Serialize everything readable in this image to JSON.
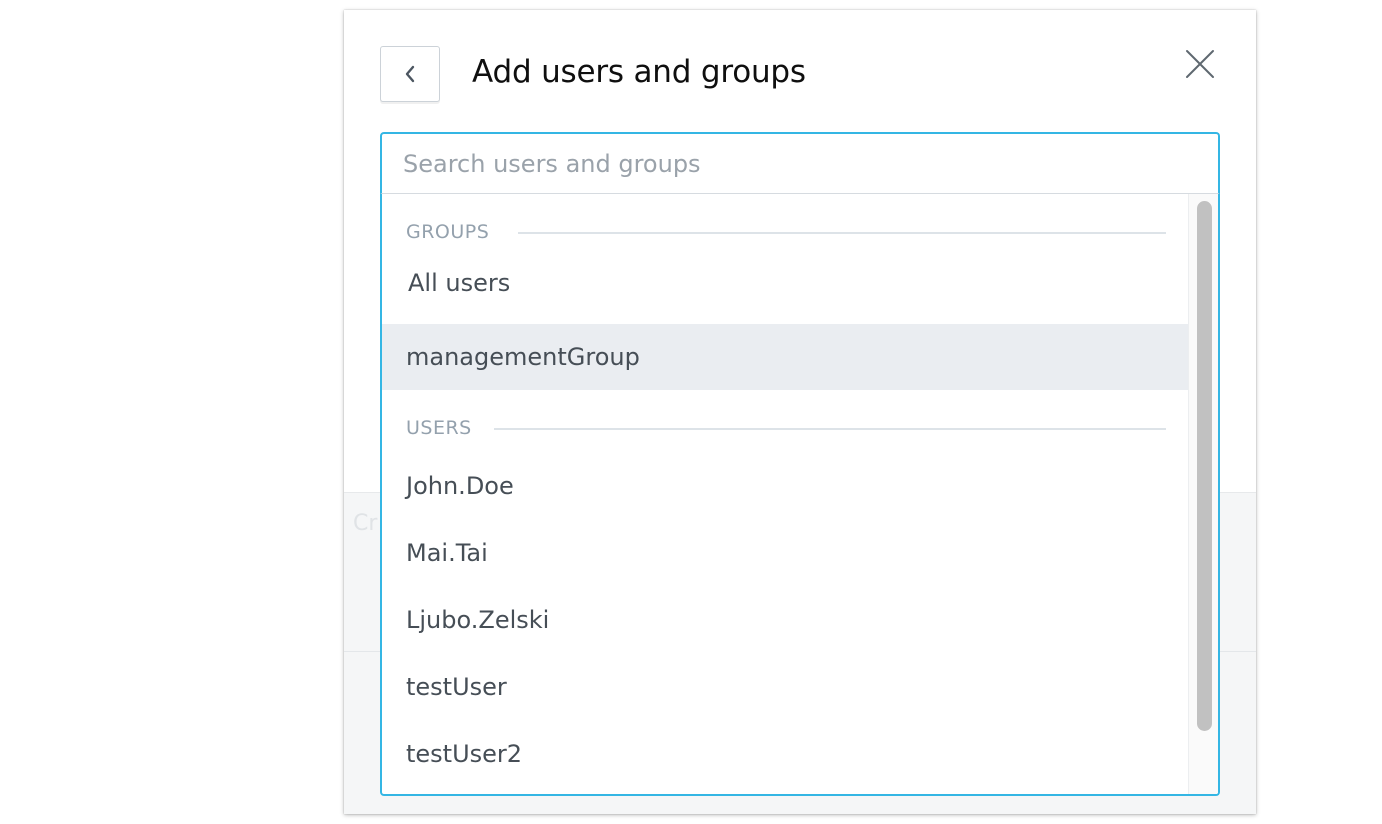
{
  "dialog": {
    "title": "Add users and groups",
    "back_icon": "chevron-left-icon",
    "close_icon": "close-icon"
  },
  "background": {
    "partial_text": "Cr"
  },
  "search": {
    "placeholder": "Search users and groups",
    "value": ""
  },
  "dropdown": {
    "groups_header": "GROUPS",
    "groups": [
      {
        "label": "All users",
        "highlighted": false
      },
      {
        "label": "managementGroup",
        "highlighted": true
      }
    ],
    "users_header": "USERS",
    "users": [
      {
        "label": "John.Doe"
      },
      {
        "label": "Mai.Tai"
      },
      {
        "label": "Ljubo.Zelski"
      },
      {
        "label": "testUser"
      },
      {
        "label": "testUser2"
      }
    ]
  },
  "colors": {
    "accent": "#34b6e4",
    "highlight": "#eaedf1",
    "section_label": "#94a1ad",
    "option_text": "#464e56"
  }
}
